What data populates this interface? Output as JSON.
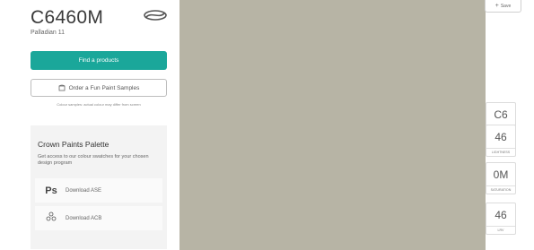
{
  "product": {
    "code": "C6460M",
    "name": "Palladian 11"
  },
  "actions": {
    "find_products": "Find a products",
    "order_sample": "Order a Fun Paint Samples",
    "sample_note": "Colour samples: actual colour may differ from screen"
  },
  "palette": {
    "title": "Crown Paints Palette",
    "description": "Get access to our colour swatches for your chosen design program",
    "downloads": [
      {
        "icon": "Ps",
        "label": "Download ASE"
      },
      {
        "icon": "acb-icon",
        "label": "Download ACB"
      }
    ]
  },
  "toolbar": {
    "save_label": "Save"
  },
  "specs": [
    {
      "value": "C6",
      "label": "HUE"
    },
    {
      "value": "46",
      "label": "LIGHTNESS"
    },
    {
      "value": "0M",
      "label": "SATURATION"
    },
    {
      "value": "46",
      "label": "LRV"
    }
  ],
  "colors": {
    "swatch": "#b7b4a5",
    "accent": "#1aa79a"
  }
}
